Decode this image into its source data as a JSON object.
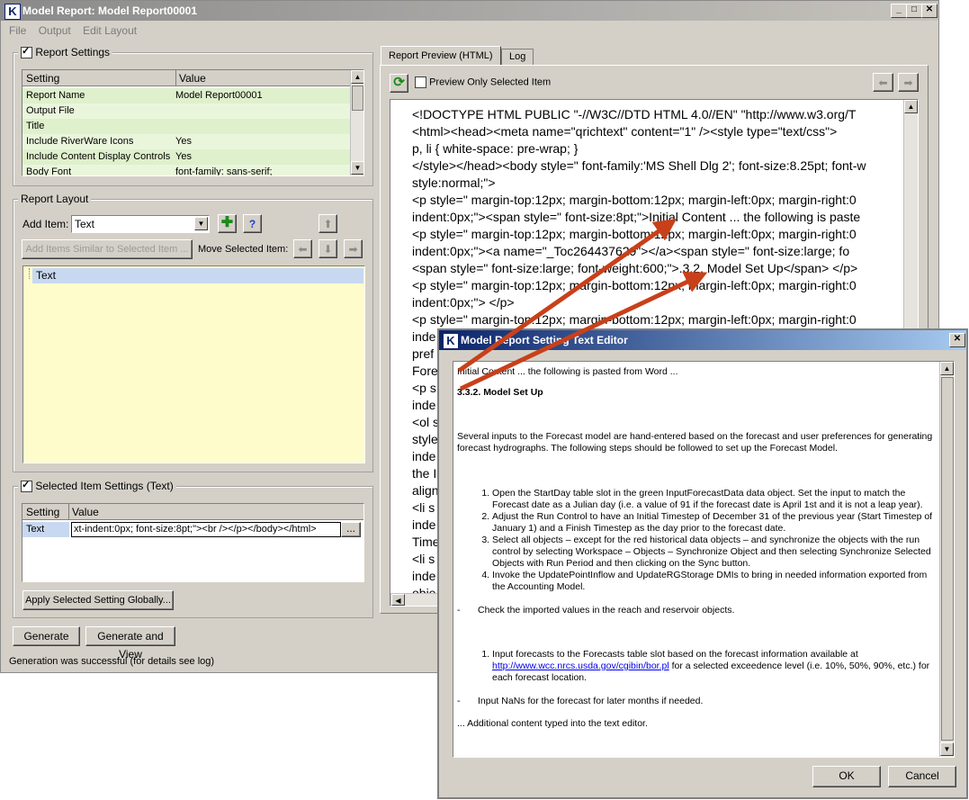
{
  "window": {
    "title": "Model Report: Model Report00001",
    "min": "_",
    "max": "□",
    "close": "✕"
  },
  "menu": [
    "File",
    "Output",
    "Edit Layout"
  ],
  "report_settings": {
    "label": "Report Settings",
    "headers": [
      "Setting",
      "Value"
    ],
    "rows": [
      {
        "setting": "Report Name",
        "value": "Model Report00001"
      },
      {
        "setting": "Output File",
        "value": ""
      },
      {
        "setting": "Title",
        "value": ""
      },
      {
        "setting": "Include RiverWare Icons",
        "value": "Yes"
      },
      {
        "setting": "Include Content Display Controls",
        "value": "Yes"
      },
      {
        "setting": "Body Font",
        "value": "font-family: sans-serif;"
      }
    ]
  },
  "report_layout": {
    "label": "Report Layout",
    "add_item_label": "Add Item:",
    "add_item_value": "Text",
    "add_similar_label": "Add Items Similar to Selected Item ...",
    "move_label": "Move Selected Item:",
    "items": [
      "Text"
    ],
    "help": "?"
  },
  "selected_item": {
    "label": "Selected Item Settings (Text)",
    "headers": [
      "Setting",
      "Value"
    ],
    "row": {
      "setting": "Text",
      "value": "xt-indent:0px; font-size:8pt;\"><br /></p></body></html>"
    },
    "ellipsis": "...",
    "apply_label": "Apply Selected Setting Globally..."
  },
  "buttons": {
    "generate": "Generate",
    "generate_view": "Generate and View"
  },
  "status": "Generation was successful (for details see log)",
  "tabs": [
    "Report Preview (HTML)",
    "Log"
  ],
  "preview": {
    "only_selected_label": "Preview Only Selected Item",
    "lines": [
      "<!DOCTYPE HTML PUBLIC \"-//W3C//DTD HTML 4.0//EN\" \"http://www.w3.org/T",
      "<html><head><meta name=\"qrichtext\" content=\"1\" /><style type=\"text/css\">",
      "p, li { white-space: pre-wrap; }",
      "</style></head><body style=\" font-family:'MS Shell Dlg 2'; font-size:8.25pt; font-w",
      "style:normal;\">",
      "<p style=\" margin-top:12px; margin-bottom:12px; margin-left:0px; margin-right:0",
      "indent:0px;\"><span style=\" font-size:8pt;\">Initial Content ... the following is paste",
      "<p style=\" margin-top:12px; margin-bottom:12px; margin-left:0px; margin-right:0",
      "indent:0px;\"><a name=\"_Toc264437629\"></a><span style=\" font-size:large; fo",
      "<span style=\" font-size:large; font-weight:600;\">.3.2. Model Set Up</span> </p>",
      "<p style=\" margin-top:12px; margin-bottom:12px; margin-left:0px; margin-right:0",
      "indent:0px;\">  </p>",
      "<p style=\" margin-top:12px; margin-bottom:12px; margin-left:0px; margin-right:0",
      "inde",
      "pref",
      "Fore",
      "<p s",
      "inde",
      "<ol s",
      "style",
      "inde",
      "the I",
      "align",
      "<li s",
      "inde",
      "Time",
      "<li s",
      "inde",
      "obje"
    ]
  },
  "editor": {
    "title": "Model Report Setting Text Editor",
    "intro": "Initial Content ... the following is pasted from Word ...",
    "heading": "3.3.2. Model Set Up",
    "para": "Several inputs to the Forecast model are hand-entered based on the forecast and user preferences for generating forecast hydrographs.  The following steps should be followed to set up the Forecast Model.",
    "steps": [
      "Open the StartDay table slot in the green InputForecastData data object.  Set the input to match the Forecast date as a Julian day (i.e. a value of 91 if the forecast date is April 1st and it is not a leap year).",
      "Adjust the Run Control to have an Initial Timestep of December 31 of the previous year (Start Timestep of January 1) and a Finish Timestep as the day prior to the forecast date.",
      "Select all objects – except for the red historical data objects – and synchronize the objects with the run control by selecting Workspace – Objects – Synchronize Object and then selecting Synchronize Selected Objects with Run Period and then clicking on the Sync button.",
      "Invoke the UpdatePointInflow and UpdateRGStorage DMIs to bring in needed information exported from the Accounting Model."
    ],
    "bullet1": "Check the imported values in the reach and reservoir objects.",
    "step2_pre": "Input forecasts to the Forecasts table slot based on the forecast information available at ",
    "step2_link": "http://www.wcc.nrcs.usda.gov/cgibin/bor.pl",
    "step2_post": " for a selected exceedence level (i.e. 10%, 50%, 90%, etc.) for each forecast location.",
    "bullet2": "Input NaNs for the forecast for later months if needed.",
    "closing": "... Additional content typed into the text editor.",
    "ok": "OK",
    "cancel": "Cancel"
  }
}
